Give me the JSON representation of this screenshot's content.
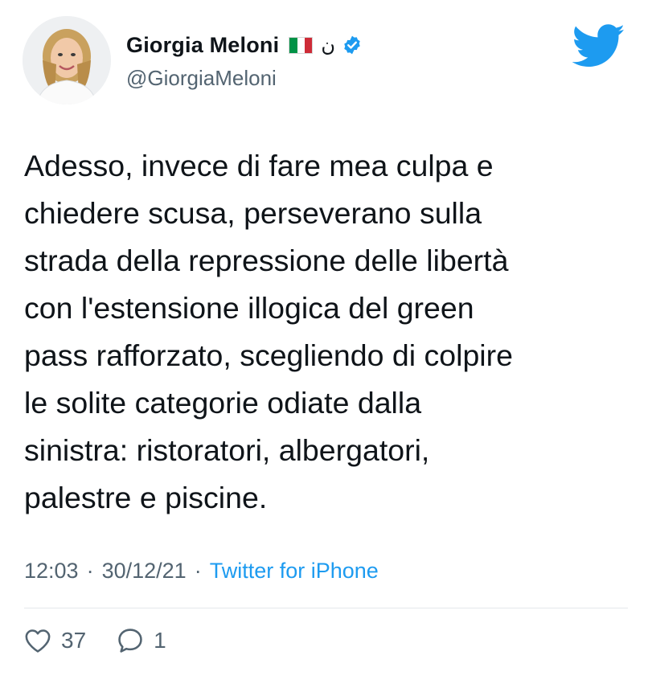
{
  "tweet": {
    "display_name": "Giorgia Meloni",
    "name_glyph": "ن",
    "handle": "@GiorgiaMeloni",
    "text": "Adesso, invece di fare mea culpa e\nchiedere scusa, perseverano sulla\nstrada della repressione delle libertà\ncon l'estensione illogica del green\npass rafforzato, scegliendo di colpire\nle solite categorie odiate dalla\nsinistra: ristoratori, albergatori,\npalestre e piscine.",
    "time": "12:03",
    "date": "30/12/21",
    "separator": "·",
    "source": "Twitter for iPhone",
    "likes": "37",
    "replies": "1"
  },
  "icons": {
    "flag": "italy-flag-icon",
    "verified": "verified-badge-icon",
    "logo": "twitter-bird-icon",
    "like": "heart-icon",
    "reply": "reply-bubble-icon"
  },
  "colors": {
    "accent": "#1d9bf0",
    "text": "#0f1419",
    "secondary": "#536471",
    "flag_green": "#009246",
    "flag_white": "#ffffff",
    "flag_red": "#ce2b37"
  }
}
